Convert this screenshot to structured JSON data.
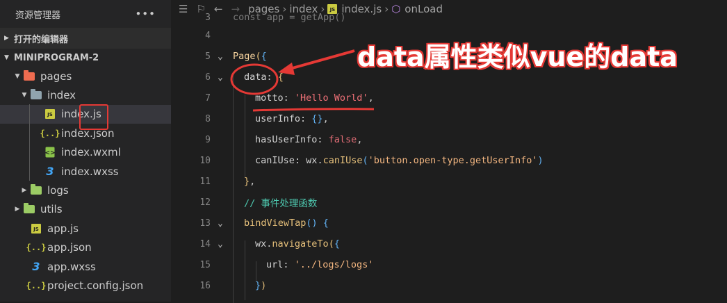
{
  "sidebar": {
    "title": "资源管理器",
    "more": "•••",
    "open_editors": "打开的编辑器",
    "project": "MINIPROGRAM-2",
    "tree": [
      {
        "label": "pages",
        "kind": "folder-open",
        "color": "#ef6c50"
      },
      {
        "label": "index",
        "kind": "folder-open",
        "color": "#90a4ae"
      },
      {
        "label": "index.js",
        "kind": "js",
        "selected": true
      },
      {
        "label": "index.json",
        "kind": "json"
      },
      {
        "label": "index.wxml",
        "kind": "wxml"
      },
      {
        "label": "index.wxss",
        "kind": "css"
      },
      {
        "label": "logs",
        "kind": "folder",
        "color": "#9ccc65"
      },
      {
        "label": "utils",
        "kind": "folder",
        "color": "#9ccc65"
      },
      {
        "label": "app.js",
        "kind": "js"
      },
      {
        "label": "app.json",
        "kind": "json"
      },
      {
        "label": "app.wxss",
        "kind": "css"
      },
      {
        "label": "project.config.json",
        "kind": "json"
      }
    ]
  },
  "breadcrumb": {
    "items": [
      "pages",
      "index",
      "index.js",
      "onLoad"
    ],
    "js_badge": "JS"
  },
  "code": {
    "line3": "const app = getApp()",
    "lines": [
      {
        "n": "3"
      },
      {
        "n": "4"
      },
      {
        "n": "5"
      },
      {
        "n": "6"
      },
      {
        "n": "7"
      },
      {
        "n": "8"
      },
      {
        "n": "9"
      },
      {
        "n": "10"
      },
      {
        "n": "11"
      },
      {
        "n": "12"
      },
      {
        "n": "13"
      },
      {
        "n": "14"
      },
      {
        "n": "15"
      },
      {
        "n": "16"
      }
    ],
    "page_kw": "Page",
    "data_key": "data",
    "motto_key": "motto",
    "motto_val": "'Hello World'",
    "userinfo_key": "userInfo",
    "hasuserinfo_key": "hasUserInfo",
    "false_val": "false",
    "caniuse_key": "canIUse",
    "wx": "wx",
    "caniuse_fn": "canIUse",
    "caniuse_arg": "'button.open-type.getUserInfo'",
    "comment": "// 事件处理函数",
    "bindview_fn": "bindViewTap",
    "navigate_fn": "navigateTo",
    "url_key": "url",
    "url_val": "'../logs/logs'"
  },
  "annotation": {
    "text": "data属性类似vue的data",
    "color": "#e53935"
  }
}
